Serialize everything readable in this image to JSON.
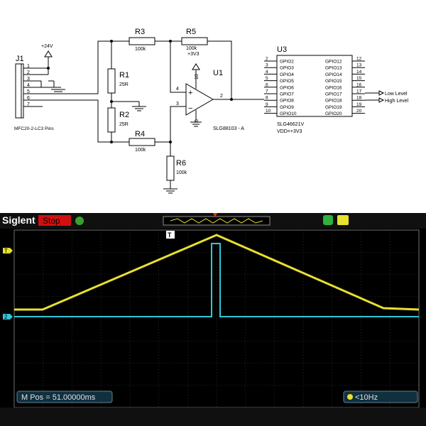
{
  "schematic": {
    "j1": {
      "ref": "J1",
      "pins": [
        "1",
        "2",
        "3",
        "4",
        "5",
        "6",
        "7"
      ],
      "caption": "MFC20-2-LC3 Pins"
    },
    "supply": "+24V",
    "resistors": [
      {
        "ref": "R1",
        "value": "25R"
      },
      {
        "ref": "R2",
        "value": "25R"
      },
      {
        "ref": "R3",
        "value": "100k"
      },
      {
        "ref": "R4",
        "value": "100k"
      },
      {
        "ref": "R5",
        "value": "100k"
      },
      {
        "ref": "R6",
        "value": "100k"
      }
    ],
    "opamp": {
      "ref": "U1",
      "part": "SLG88103 - A",
      "supply": "+3V3",
      "pins": {
        "plus": "4",
        "minus": "3",
        "out": "2",
        "vdd": "10",
        "gnd": "5"
      },
      "plus_sign": "+",
      "minus_sign": "−"
    },
    "u3": {
      "ref": "U3",
      "part": "SLG46621V",
      "vdd": "VDD=+3V3",
      "left_pins": [
        {
          "num": "2",
          "name": "GPIO2"
        },
        {
          "num": "3",
          "name": "GPIO3"
        },
        {
          "num": "4",
          "name": "GPIO4"
        },
        {
          "num": "5",
          "name": "GPIO5"
        },
        {
          "num": "6",
          "name": "GPIO6"
        },
        {
          "num": "7",
          "name": "GPIO7"
        },
        {
          "num": "8",
          "name": "GPIO8"
        },
        {
          "num": "9",
          "name": "GPIO9"
        },
        {
          "num": "10",
          "name": "GPIO10"
        }
      ],
      "right_pins": [
        {
          "num": "12",
          "name": "GPIO12"
        },
        {
          "num": "13",
          "name": "GPIO13"
        },
        {
          "num": "14",
          "name": "GPIO14"
        },
        {
          "num": "15",
          "name": "GPIO15"
        },
        {
          "num": "16",
          "name": "GPIO16"
        },
        {
          "num": "17",
          "name": "GPIO17"
        },
        {
          "num": "18",
          "name": "GPIO18"
        },
        {
          "num": "19",
          "name": "GPIO19"
        },
        {
          "num": "20",
          "name": "GPIO20"
        }
      ],
      "outputs": [
        "Low Level",
        "High Level"
      ]
    }
  },
  "scope": {
    "brand": "Siglent",
    "status": "Stop",
    "trigger_marker": "T",
    "ch1_marker": "T",
    "ch2_marker": "2",
    "mpos": "M Pos = 51.00000ms",
    "freq": "<10Hz",
    "colors": {
      "ch1": "#e8e030",
      "ch2": "#30c8d8",
      "grid": "#505050",
      "status_bg": "#d01010"
    }
  }
}
